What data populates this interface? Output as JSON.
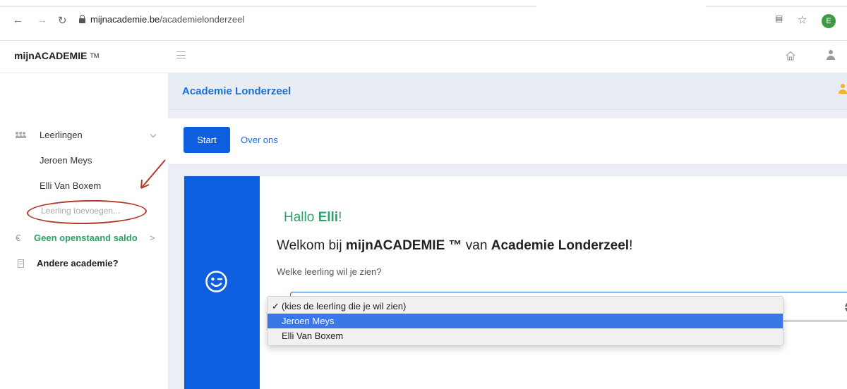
{
  "browser": {
    "url_host": "mijnacademie.be",
    "url_path": "/academielonderzeel",
    "profile_initial": "E"
  },
  "app": {
    "brand": "mijnACADEMIE",
    "brand_tm": "TM"
  },
  "sidebar": {
    "students_label": "Leerlingen",
    "students": [
      "Jeroen Meys",
      "Elli Van Boxem"
    ],
    "add_student": "Leerling toevoegen...",
    "saldo": "Geen openstaand saldo",
    "saldo_chevron": ">",
    "euro_symbol": "€",
    "other_academy": "Andere academie?"
  },
  "content": {
    "title": "Academie Londerzeel",
    "tabs": [
      "Start",
      "Over ons"
    ],
    "hello_prefix": "Hallo ",
    "hello_name": "Elli",
    "hello_suffix": "!",
    "welcome_prefix": "Welkom bij ",
    "welcome_brand": "mijnACADEMIE ™",
    "welcome_mid": " van ",
    "welcome_academy": "Academie Londerzeel",
    "welcome_suffix": "!",
    "question": "Welke leerling wil je zien?"
  },
  "dropdown": {
    "check": "✓",
    "options": [
      "(kies de leerling die je wil zien)",
      "Jeroen Meys",
      "Elli Van Boxem"
    ],
    "selected_index": 0,
    "highlighted_index": 1
  },
  "colors": {
    "primary": "#0d5fe0",
    "link": "#1a6fd9",
    "green": "#2ba36a",
    "annotation": "#b23a2a"
  }
}
